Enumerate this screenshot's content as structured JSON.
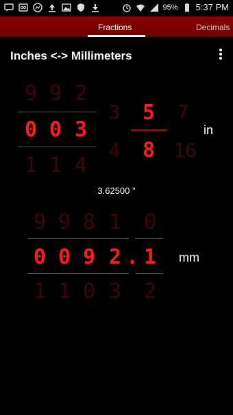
{
  "status_bar": {
    "left_icons": [
      "message-icon",
      "voicemail-icon",
      "messenger-icon",
      "upload-icon",
      "image-icon",
      "shield-icon",
      "download-icon"
    ],
    "right_icons": [
      "alarm-icon",
      "wifi-icon",
      "signal-icon"
    ],
    "battery": "95%",
    "time": "5:37 PM"
  },
  "tabs": [
    {
      "label": "Fractions",
      "selected": true
    },
    {
      "label": "Decimals",
      "selected": false
    }
  ],
  "toolbar": {
    "title": "Inches <-> Millimeters",
    "menu_icon": "more-vert-icon"
  },
  "inches": {
    "whole": {
      "above": [
        "9",
        "9",
        "2"
      ],
      "current": [
        "0",
        "0",
        "3"
      ],
      "below": [
        "1",
        "1",
        "4"
      ]
    },
    "numerator": {
      "above": "3",
      "current": "5",
      "below": "4"
    },
    "denominator": {
      "above": "7",
      "current": "8",
      "below": "16"
    },
    "unit": "in"
  },
  "decimal_readout": "3.62500 \"",
  "millimeters": {
    "above": [
      "9",
      "9",
      "8",
      "1",
      "0"
    ],
    "current": [
      "0",
      "0",
      "9",
      "2",
      "1"
    ],
    "below": [
      "1",
      "1",
      "0",
      "3",
      "2"
    ],
    "decimal_point": ".",
    "unit": "mm"
  },
  "colors": {
    "accent": "#ff1b1b",
    "tab_bar": "#7a0000",
    "dim_digit": "#3a0707"
  }
}
